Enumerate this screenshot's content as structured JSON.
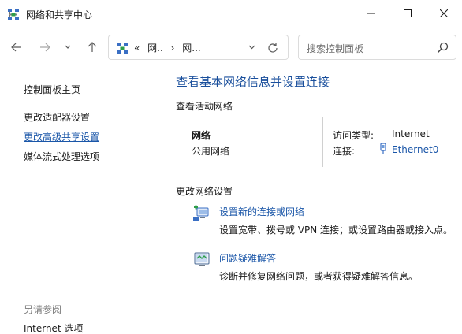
{
  "window": {
    "title": "网络和共享中心"
  },
  "address": {
    "crumbs": [
      "«",
      "网..",
      "›",
      "网..."
    ]
  },
  "search": {
    "placeholder": "搜索控制面板"
  },
  "sidebar": {
    "items": [
      {
        "label": "控制面板主页"
      },
      {
        "label": "更改适配器设置"
      },
      {
        "label": "更改高级共享设置"
      },
      {
        "label": "媒体流式处理选项"
      }
    ],
    "see_also_header": "另请参阅",
    "see_also": [
      {
        "label": "Internet 选项"
      }
    ]
  },
  "main": {
    "title": "查看基本网络信息并设置连接",
    "active_header": "查看活动网络",
    "network": {
      "name": "网络",
      "type": "公用网络",
      "access_label": "访问类型:",
      "access_value": "Internet",
      "conn_label": "连接:",
      "conn_value": "Ethernet0"
    },
    "change_header": "更改网络设置",
    "tasks": [
      {
        "link": "设置新的连接或网络",
        "desc": "设置宽带、拨号或 VPN 连接；或设置路由器或接入点。",
        "icon": "new-connection-icon"
      },
      {
        "link": "问题疑难解答",
        "desc": "诊断并修复网络问题，或者获得疑难解答信息。",
        "icon": "troubleshoot-icon"
      }
    ]
  },
  "colors": {
    "link": "#1a56a8",
    "title": "#1a4f9c"
  }
}
